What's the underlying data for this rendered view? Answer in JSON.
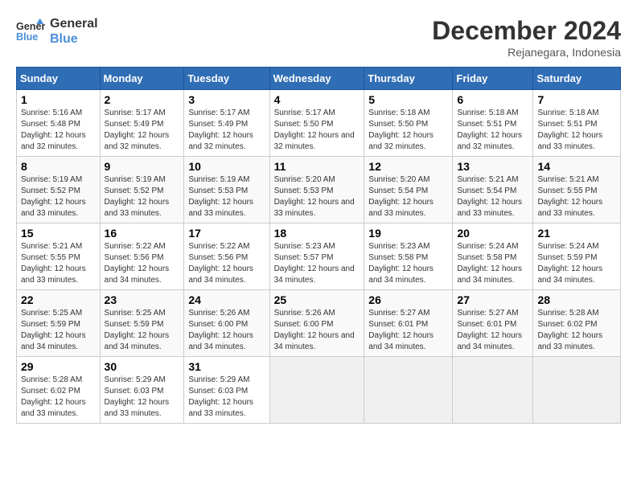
{
  "header": {
    "logo_line1": "General",
    "logo_line2": "Blue",
    "month": "December 2024",
    "location": "Rejanegara, Indonesia"
  },
  "weekdays": [
    "Sunday",
    "Monday",
    "Tuesday",
    "Wednesday",
    "Thursday",
    "Friday",
    "Saturday"
  ],
  "weeks": [
    [
      {
        "day": 1,
        "sunrise": "5:16 AM",
        "sunset": "5:48 PM",
        "daylight": "12 hours and 32 minutes."
      },
      {
        "day": 2,
        "sunrise": "5:17 AM",
        "sunset": "5:49 PM",
        "daylight": "12 hours and 32 minutes."
      },
      {
        "day": 3,
        "sunrise": "5:17 AM",
        "sunset": "5:49 PM",
        "daylight": "12 hours and 32 minutes."
      },
      {
        "day": 4,
        "sunrise": "5:17 AM",
        "sunset": "5:50 PM",
        "daylight": "12 hours and 32 minutes."
      },
      {
        "day": 5,
        "sunrise": "5:18 AM",
        "sunset": "5:50 PM",
        "daylight": "12 hours and 32 minutes."
      },
      {
        "day": 6,
        "sunrise": "5:18 AM",
        "sunset": "5:51 PM",
        "daylight": "12 hours and 32 minutes."
      },
      {
        "day": 7,
        "sunrise": "5:18 AM",
        "sunset": "5:51 PM",
        "daylight": "12 hours and 33 minutes."
      }
    ],
    [
      {
        "day": 8,
        "sunrise": "5:19 AM",
        "sunset": "5:52 PM",
        "daylight": "12 hours and 33 minutes."
      },
      {
        "day": 9,
        "sunrise": "5:19 AM",
        "sunset": "5:52 PM",
        "daylight": "12 hours and 33 minutes."
      },
      {
        "day": 10,
        "sunrise": "5:19 AM",
        "sunset": "5:53 PM",
        "daylight": "12 hours and 33 minutes."
      },
      {
        "day": 11,
        "sunrise": "5:20 AM",
        "sunset": "5:53 PM",
        "daylight": "12 hours and 33 minutes."
      },
      {
        "day": 12,
        "sunrise": "5:20 AM",
        "sunset": "5:54 PM",
        "daylight": "12 hours and 33 minutes."
      },
      {
        "day": 13,
        "sunrise": "5:21 AM",
        "sunset": "5:54 PM",
        "daylight": "12 hours and 33 minutes."
      },
      {
        "day": 14,
        "sunrise": "5:21 AM",
        "sunset": "5:55 PM",
        "daylight": "12 hours and 33 minutes."
      }
    ],
    [
      {
        "day": 15,
        "sunrise": "5:21 AM",
        "sunset": "5:55 PM",
        "daylight": "12 hours and 33 minutes."
      },
      {
        "day": 16,
        "sunrise": "5:22 AM",
        "sunset": "5:56 PM",
        "daylight": "12 hours and 34 minutes."
      },
      {
        "day": 17,
        "sunrise": "5:22 AM",
        "sunset": "5:56 PM",
        "daylight": "12 hours and 34 minutes."
      },
      {
        "day": 18,
        "sunrise": "5:23 AM",
        "sunset": "5:57 PM",
        "daylight": "12 hours and 34 minutes."
      },
      {
        "day": 19,
        "sunrise": "5:23 AM",
        "sunset": "5:58 PM",
        "daylight": "12 hours and 34 minutes."
      },
      {
        "day": 20,
        "sunrise": "5:24 AM",
        "sunset": "5:58 PM",
        "daylight": "12 hours and 34 minutes."
      },
      {
        "day": 21,
        "sunrise": "5:24 AM",
        "sunset": "5:59 PM",
        "daylight": "12 hours and 34 minutes."
      }
    ],
    [
      {
        "day": 22,
        "sunrise": "5:25 AM",
        "sunset": "5:59 PM",
        "daylight": "12 hours and 34 minutes."
      },
      {
        "day": 23,
        "sunrise": "5:25 AM",
        "sunset": "5:59 PM",
        "daylight": "12 hours and 34 minutes."
      },
      {
        "day": 24,
        "sunrise": "5:26 AM",
        "sunset": "6:00 PM",
        "daylight": "12 hours and 34 minutes."
      },
      {
        "day": 25,
        "sunrise": "5:26 AM",
        "sunset": "6:00 PM",
        "daylight": "12 hours and 34 minutes."
      },
      {
        "day": 26,
        "sunrise": "5:27 AM",
        "sunset": "6:01 PM",
        "daylight": "12 hours and 34 minutes."
      },
      {
        "day": 27,
        "sunrise": "5:27 AM",
        "sunset": "6:01 PM",
        "daylight": "12 hours and 34 minutes."
      },
      {
        "day": 28,
        "sunrise": "5:28 AM",
        "sunset": "6:02 PM",
        "daylight": "12 hours and 33 minutes."
      }
    ],
    [
      {
        "day": 29,
        "sunrise": "5:28 AM",
        "sunset": "6:02 PM",
        "daylight": "12 hours and 33 minutes."
      },
      {
        "day": 30,
        "sunrise": "5:29 AM",
        "sunset": "6:03 PM",
        "daylight": "12 hours and 33 minutes."
      },
      {
        "day": 31,
        "sunrise": "5:29 AM",
        "sunset": "6:03 PM",
        "daylight": "12 hours and 33 minutes."
      },
      null,
      null,
      null,
      null
    ]
  ]
}
